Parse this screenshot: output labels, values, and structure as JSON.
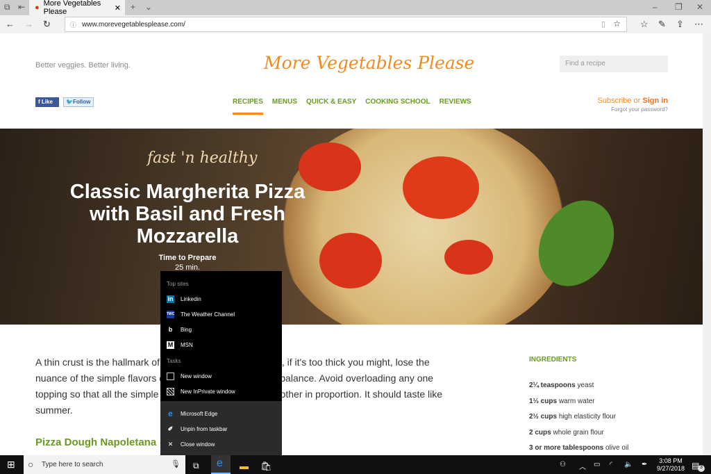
{
  "browser": {
    "tab_title": "Microsoft Edge tab",
    "tab_label": "More Vegetables Please",
    "url": "www.morevegetablesplease.com/"
  },
  "site": {
    "tagline": "Better veggies. Better living.",
    "logo": "More Vegetables Please",
    "search_placeholder": "Find a recipe",
    "fb_like": "Like",
    "tw_follow": "Follow",
    "menu": [
      "RECIPES",
      "MENUS",
      "QUICK & EASY",
      "COOKING SCHOOL",
      "REVIEWS"
    ],
    "subscribe": "Subscribe or",
    "sign_in": "Sign in",
    "forgot": "Forgot your password?"
  },
  "hero": {
    "kicker": "fast 'n healthy",
    "title": "Classic Margherita Pizza with Basil and Fresh Mozzarella",
    "time_label": "Time to Prepare",
    "time_value": "25 min."
  },
  "article": {
    "body": "A thin crust is the hallmark of a Neapolitan pizza because, if it's too thick you might, lose the nuance of the simple flavors of the toppings. They key is balance. Avoid overloading any one topping so that all the simple ingriedients balance one another in proportion. It should taste like summer.",
    "subheading": "Pizza Dough Napoletana"
  },
  "ingredients": {
    "heading": "INGREDIENTS",
    "items": [
      {
        "qty": "2¼ teaspoons",
        "name": "yeast"
      },
      {
        "qty": "1⅓ cups",
        "name": "warm water"
      },
      {
        "qty": "2½ cups",
        "name": "high elasticity flour"
      },
      {
        "qty": "2 cups",
        "name": "whole grain flour"
      },
      {
        "qty": "3 or more tablespoons",
        "name": "olive oil"
      }
    ]
  },
  "jumplist": {
    "top_sites_label": "Top sites",
    "top_sites": [
      "Linkedin",
      "The Weather Channel",
      "Bing",
      "MSN"
    ],
    "tasks_label": "Tasks",
    "tasks": [
      "New window",
      "New InPrivate window"
    ],
    "app": [
      "Microsoft Edge",
      "Unpin from taskbar",
      "Close window"
    ]
  },
  "taskbar": {
    "search_placeholder": "Type here to search",
    "time": "3:08 PM",
    "date": "9/27/2018",
    "notifications": "3"
  },
  "colors": {
    "accent_orange": "#f28a1c",
    "accent_green": "#6a9a1f"
  }
}
